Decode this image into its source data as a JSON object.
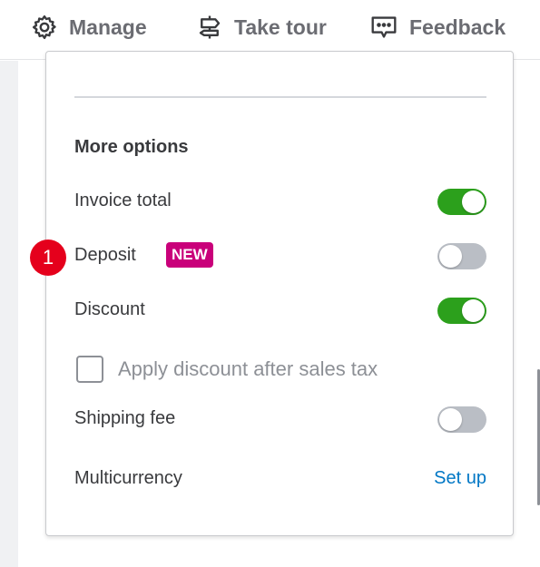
{
  "topbar": {
    "manage_label": "Manage",
    "tour_label": "Take tour",
    "feedback_label": "Feedback"
  },
  "options": {
    "title": "More options",
    "step_marker": "1",
    "invoice_total": {
      "label": "Invoice total",
      "enabled": true
    },
    "deposit": {
      "label": "Deposit",
      "badge": "NEW",
      "enabled": false
    },
    "discount": {
      "label": "Discount",
      "enabled": true
    },
    "apply_after_tax": {
      "label": "Apply discount after sales tax",
      "checked": false
    },
    "shipping_fee": {
      "label": "Shipping fee",
      "enabled": false
    },
    "multicurrency": {
      "label": "Multicurrency",
      "link_label": "Set up"
    }
  },
  "colors": {
    "toggle_on": "#2ca01c",
    "toggle_off": "#babec5",
    "badge": "#c9007a",
    "link": "#0077c5",
    "marker": "#e5001c"
  }
}
